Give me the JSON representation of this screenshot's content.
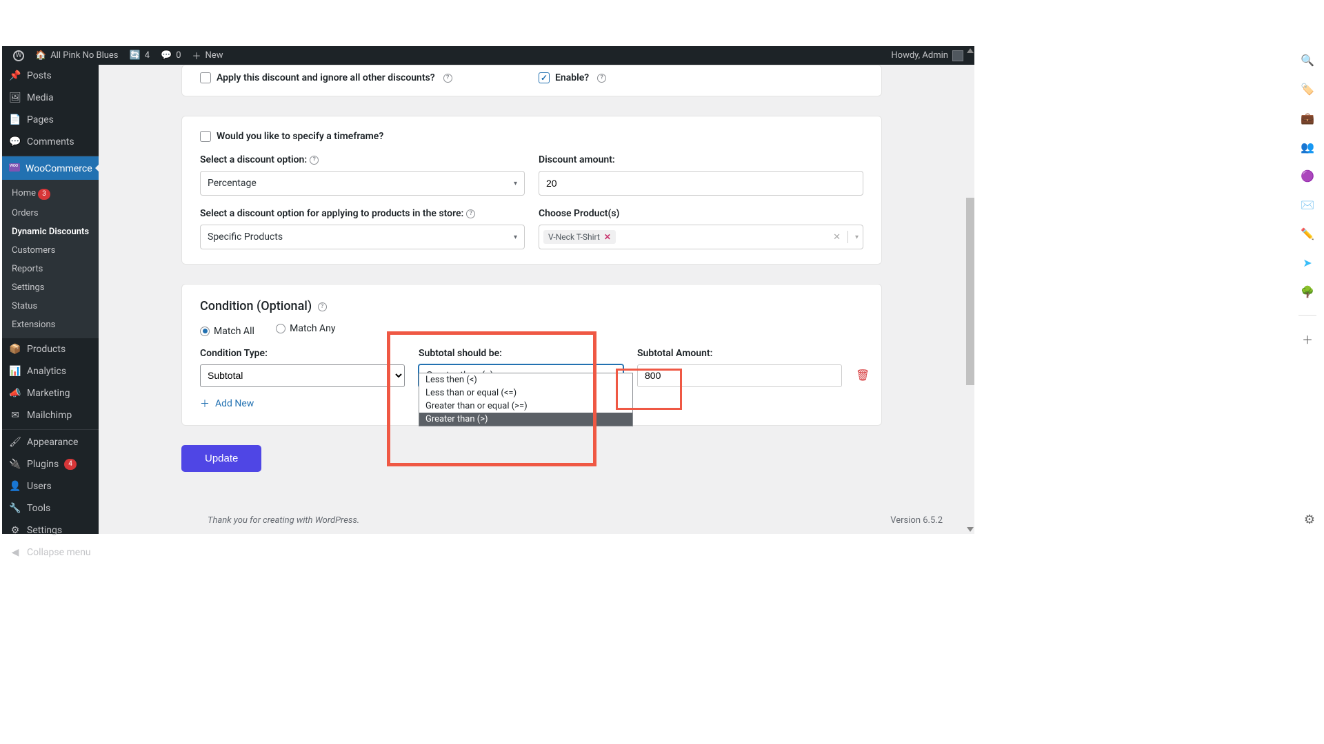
{
  "adminbar": {
    "site": "All Pink No Blues",
    "refresh_count": "4",
    "comments_count": "0",
    "new_label": "New",
    "howdy": "Howdy, Admin"
  },
  "sidebar": {
    "posts": "Posts",
    "media": "Media",
    "pages": "Pages",
    "comments": "Comments",
    "woocommerce": "WooCommerce",
    "woo_sub": {
      "home": "Home",
      "home_badge": "3",
      "orders": "Orders",
      "dynamic": "Dynamic Discounts",
      "customers": "Customers",
      "reports": "Reports",
      "settings": "Settings",
      "status": "Status",
      "extensions": "Extensions"
    },
    "products": "Products",
    "analytics": "Analytics",
    "marketing": "Marketing",
    "mailchimp": "Mailchimp",
    "appearance": "Appearance",
    "plugins": "Plugins",
    "plugins_badge": "4",
    "users": "Users",
    "tools": "Tools",
    "settings": "Settings",
    "collapse": "Collapse menu"
  },
  "card1": {
    "apply_label": "Apply this discount and ignore all other discounts?",
    "enable_label": "Enable?"
  },
  "card2": {
    "timeframe_label": "Would you like to specify a timeframe?",
    "discount_option_label": "Select a discount option:",
    "discount_option_value": "Percentage",
    "discount_amount_label": "Discount amount:",
    "discount_amount_value": "20",
    "apply_scope_label": "Select a discount option for applying to products in the store:",
    "apply_scope_value": "Specific Products",
    "choose_products_label": "Choose Product(s)",
    "product_chip": "V-Neck T-Shirt"
  },
  "card3": {
    "title": "Condition (Optional)",
    "match_all": "Match All",
    "match_any": "Match Any",
    "cond_type_label": "Condition Type:",
    "cond_type_value": "Subtotal",
    "subtotal_be_label": "Subtotal should be:",
    "subtotal_be_value": "Greater than (>)",
    "subtotal_amount_label": "Subtotal Amount:",
    "subtotal_amount_value": "800",
    "dd_opts": {
      "o1": "Less then (<)",
      "o2": "Less than or equal (<=)",
      "o3": "Greater than or equal (>=)",
      "o4": "Greater than (>)"
    },
    "add_new": "Add New"
  },
  "update_btn": "Update",
  "footer": {
    "thank": "Thank you for creating with WordPress.",
    "version": "Version 6.5.2"
  }
}
